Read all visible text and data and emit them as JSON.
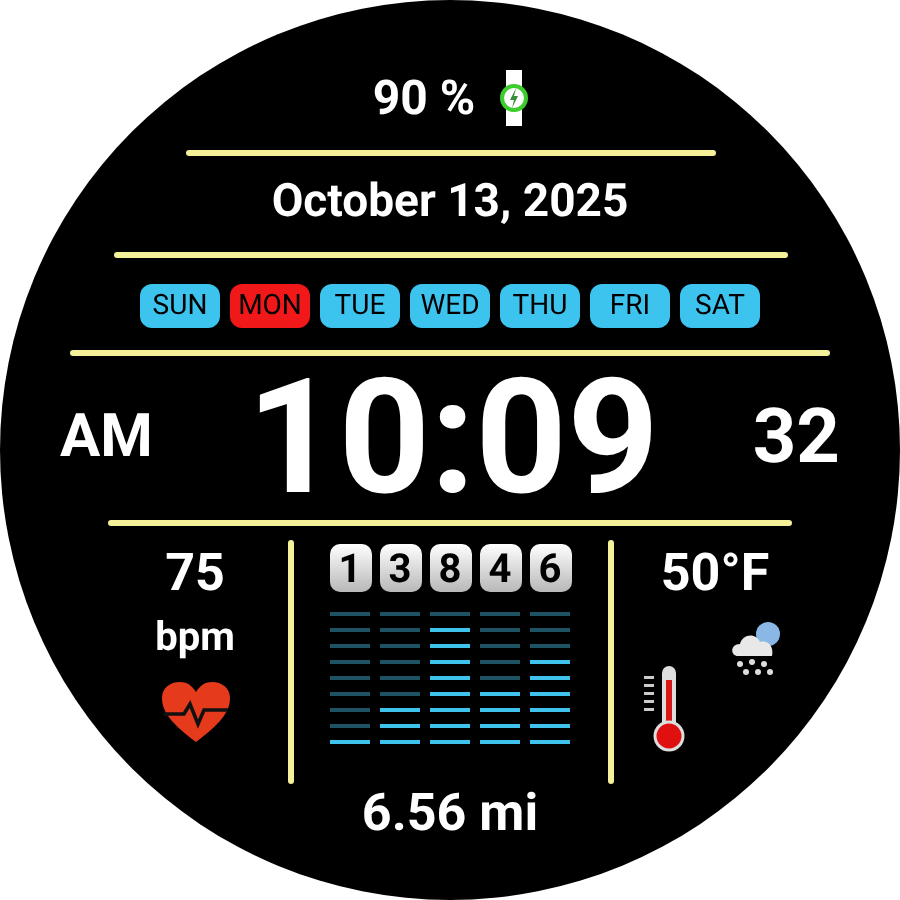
{
  "battery": {
    "reading": "90 %",
    "charging": true
  },
  "date": "October 13, 2025",
  "days": [
    {
      "label": "SUN",
      "selected": false
    },
    {
      "label": "MON",
      "selected": true
    },
    {
      "label": "TUE",
      "selected": false
    },
    {
      "label": "WED",
      "selected": false
    },
    {
      "label": "THU",
      "selected": false
    },
    {
      "label": "FRI",
      "selected": false
    },
    {
      "label": "SAT",
      "selected": false
    }
  ],
  "time": {
    "period": "AM",
    "clock": "10:09",
    "seconds": "32"
  },
  "heart_rate": {
    "value": "75",
    "unit": "bpm"
  },
  "steps": [
    {
      "digit": "1",
      "level": 0.111
    },
    {
      "digit": "3",
      "level": 0.333
    },
    {
      "digit": "8",
      "level": 0.889
    },
    {
      "digit": "4",
      "level": 0.444
    },
    {
      "digit": "6",
      "level": 0.667
    }
  ],
  "distance": "6.56 mi",
  "weather": {
    "temperature": "50°F"
  }
}
